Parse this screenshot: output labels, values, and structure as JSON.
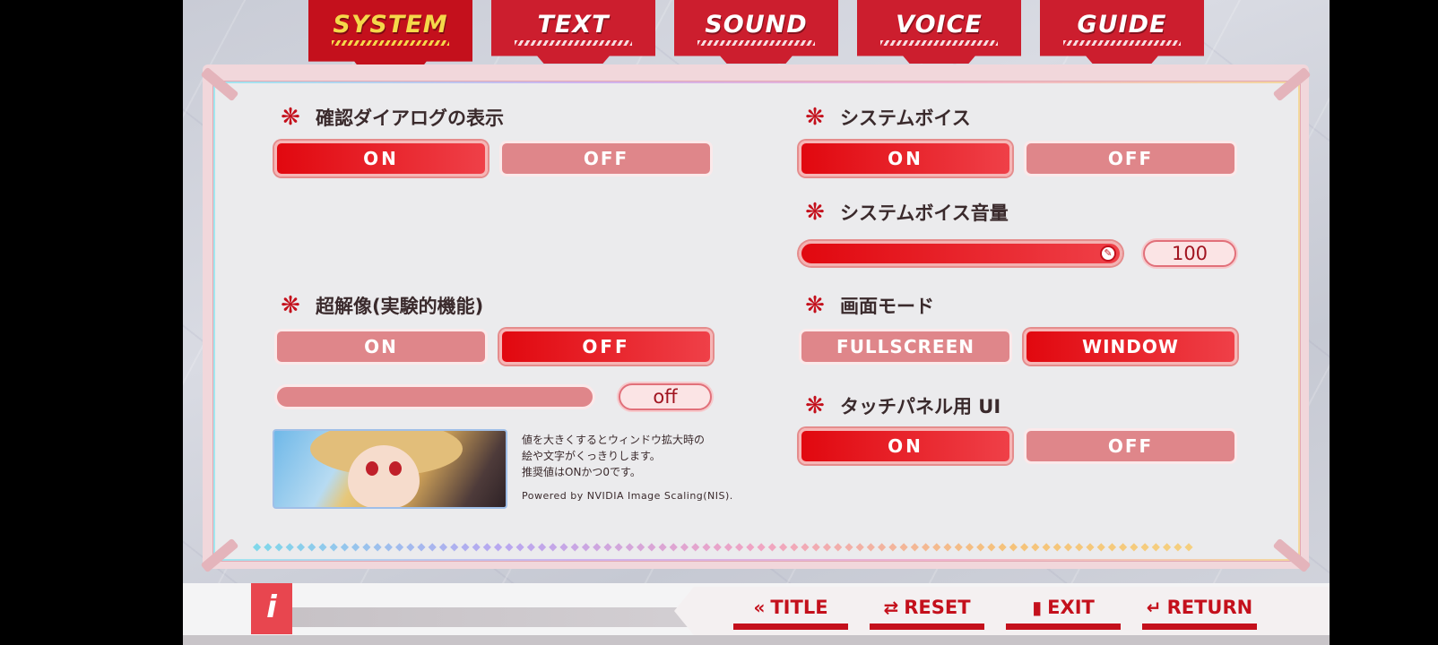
{
  "tabs": [
    {
      "label": "SYSTEM",
      "active": true
    },
    {
      "label": "TEXT",
      "active": false
    },
    {
      "label": "SOUND",
      "active": false
    },
    {
      "label": "VOICE",
      "active": false
    },
    {
      "label": "GUIDE",
      "active": false
    }
  ],
  "left": {
    "confirm_dialog": {
      "title": "確認ダイアログの表示",
      "on_label": "ON",
      "off_label": "OFF",
      "selected": "ON"
    },
    "super_resolution": {
      "title": "超解像(実験的機能)",
      "on_label": "ON",
      "off_label": "OFF",
      "selected": "OFF",
      "slider_value": "off",
      "description_line1": "値を大きくするとウィンドウ拡大時の",
      "description_line2": "絵や文字がくっきりします。",
      "description_line3": "推奨値はONかつ0です。",
      "powered_by": "Powered by NVIDIA Image Scaling(NIS)."
    }
  },
  "right": {
    "system_voice": {
      "title": "システムボイス",
      "on_label": "ON",
      "off_label": "OFF",
      "selected": "ON"
    },
    "system_voice_volume": {
      "title": "システムボイス音量",
      "value": "100",
      "level": 1.0
    },
    "screen_mode": {
      "title": "画面モード",
      "fullscreen_label": "FULLSCREEN",
      "window_label": "WINDOW",
      "selected": "WINDOW"
    },
    "touch_panel_ui": {
      "title": "タッチパネル用 UI",
      "on_label": "ON",
      "off_label": "OFF",
      "selected": "ON"
    }
  },
  "bottom": {
    "info_icon": "i",
    "title_label": "TITLE",
    "reset_label": "RESET",
    "exit_label": "EXIT",
    "return_label": "RETURN"
  },
  "colors": {
    "accent_red": "#c4101c",
    "active_tab_text": "#f5d84a",
    "off_pink": "#df868a"
  },
  "icons": [
    "snowflake-icon",
    "double-chevron-left-icon",
    "swap-arrows-icon",
    "door-exit-icon",
    "return-arrow-icon",
    "info-icon",
    "slider-knob-icon"
  ]
}
